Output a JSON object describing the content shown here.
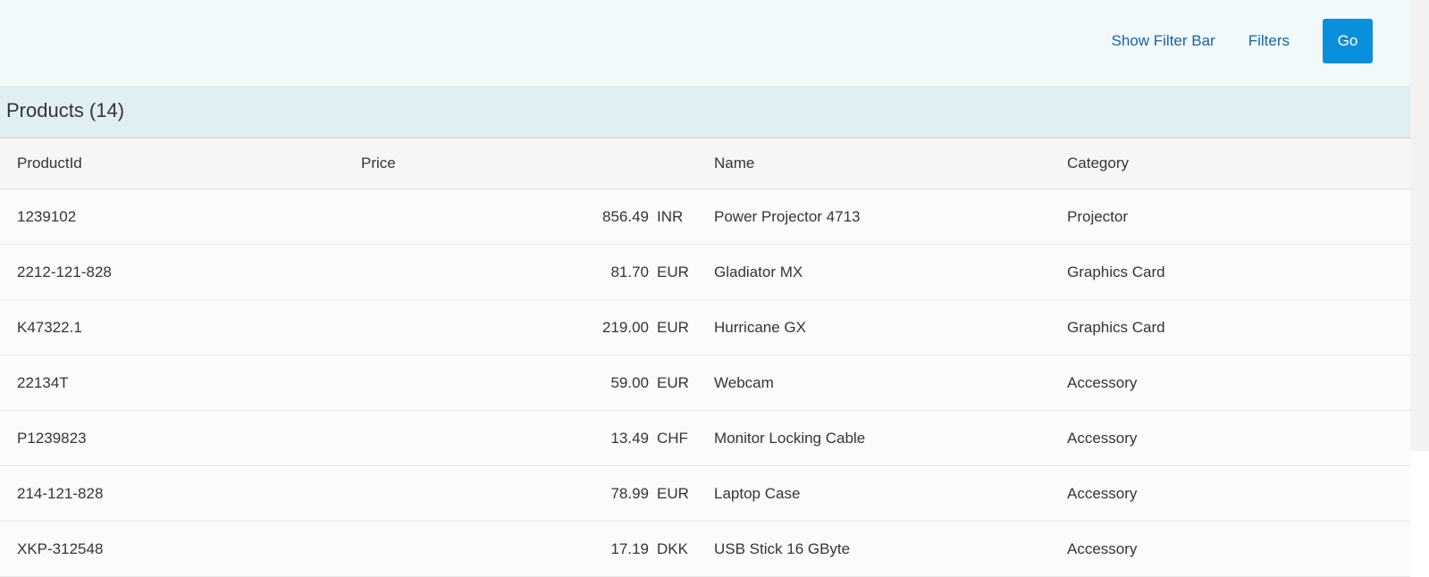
{
  "toolbar": {
    "show_filter_bar_label": "Show Filter Bar",
    "filters_label": "Filters",
    "go_label": "Go"
  },
  "table": {
    "title": "Products (14)",
    "columns": {
      "product_id": "ProductId",
      "price": "Price",
      "name": "Name",
      "category": "Category"
    },
    "rows": [
      {
        "product_id": "1239102",
        "amount": "856.49",
        "currency": "INR",
        "name": "Power Projector 4713",
        "category": "Projector"
      },
      {
        "product_id": "2212-121-828",
        "amount": "81.70",
        "currency": "EUR",
        "name": "Gladiator MX",
        "category": "Graphics Card"
      },
      {
        "product_id": "K47322.1",
        "amount": "219.00",
        "currency": "EUR",
        "name": "Hurricane GX",
        "category": "Graphics Card"
      },
      {
        "product_id": "22134T",
        "amount": "59.00",
        "currency": "EUR",
        "name": "Webcam",
        "category": "Accessory"
      },
      {
        "product_id": "P1239823",
        "amount": "13.49",
        "currency": "CHF",
        "name": "Monitor Locking Cable",
        "category": "Accessory"
      },
      {
        "product_id": "214-121-828",
        "amount": "78.99",
        "currency": "EUR",
        "name": "Laptop Case",
        "category": "Accessory"
      },
      {
        "product_id": "XKP-312548",
        "amount": "17.19",
        "currency": "DKK",
        "name": "USB Stick 16 GByte",
        "category": "Accessory"
      }
    ]
  },
  "colors": {
    "accent": "#0a8fdc",
    "link": "#1565a8",
    "filterbar_bg": "#f2f9fa",
    "table_header_bg": "#dfeff2"
  }
}
